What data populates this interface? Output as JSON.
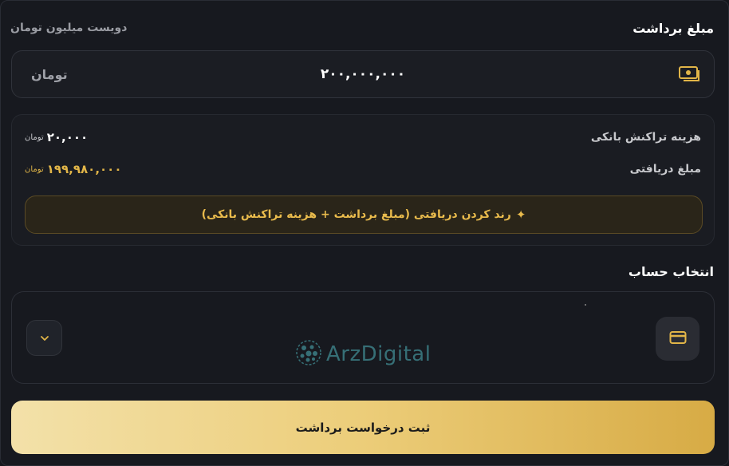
{
  "header": {
    "title": "مبلغ برداشت",
    "amount_in_words": "دویست میلیون تومان"
  },
  "amount_input": {
    "value": "۲۰۰,۰۰۰,۰۰۰",
    "currency": "تومان",
    "icon": "money-icon"
  },
  "fees": {
    "bank_fee_label": "هزینه تراکنش بانکی",
    "bank_fee_value": "۲۰,۰۰۰",
    "bank_fee_unit": "تومان",
    "received_label": "مبلغ دریافتی",
    "received_value": "۱۹۹,۹۸۰,۰۰۰",
    "received_unit": "تومان",
    "round_button_label": "رند کردن دریافتی  (مبلغ برداشت + هزینه تراکنش بانکی)",
    "round_button_icon": "sparkle-icon"
  },
  "account": {
    "title": "انتخاب حساب",
    "card_icon": "credit-card-icon",
    "dropdown_icon": "chevron-down-icon",
    "watermark": "ArzDigital"
  },
  "submit": {
    "label": "ثبت درخواست برداشت"
  },
  "colors": {
    "accent_gold": "#e1b548",
    "background": "#17191f"
  }
}
